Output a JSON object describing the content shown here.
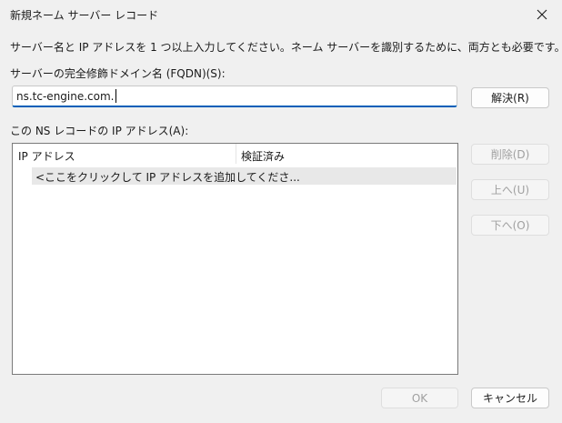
{
  "window": {
    "title": "新規ネーム サーバー レコード",
    "close_icon": "close-icon"
  },
  "instruction": "サーバー名と IP アドレスを 1 つ以上入力してください。ネーム サーバーを識別するために、両方とも必要です。",
  "fqdn": {
    "label": "サーバーの完全修飾ドメイン名 (FQDN)(S):",
    "value": "ns.tc-engine.com.",
    "resolve_button": "解決(R)"
  },
  "ip_list": {
    "label": "この NS レコードの IP アドレス(A):",
    "columns": [
      "IP アドレス",
      "検証済み"
    ],
    "placeholder_row": "<ここをクリックして IP アドレスを追加してくださ..."
  },
  "side_buttons": {
    "delete": "削除(D)",
    "up": "上へ(U)",
    "down": "下へ(O)"
  },
  "footer": {
    "ok": "OK",
    "cancel": "キャンセル"
  }
}
